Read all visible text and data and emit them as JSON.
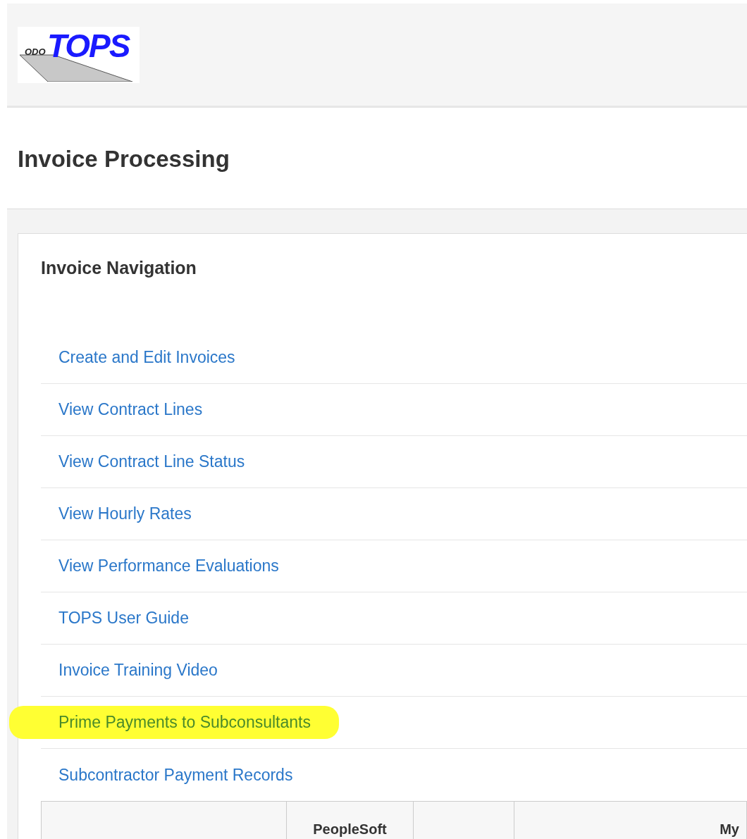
{
  "logo": {
    "prefix": "ODO",
    "name": "TOPS"
  },
  "page_title": "Invoice Processing",
  "panel": {
    "title": "Invoice Navigation",
    "links": [
      {
        "label": "Create and Edit Invoices",
        "highlighted": false
      },
      {
        "label": "View Contract Lines",
        "highlighted": false
      },
      {
        "label": "View Contract Line Status",
        "highlighted": false
      },
      {
        "label": "View Hourly Rates",
        "highlighted": false
      },
      {
        "label": "View Performance Evaluations",
        "highlighted": false
      },
      {
        "label": "TOPS User Guide",
        "highlighted": false
      },
      {
        "label": "Invoice Training Video",
        "highlighted": false
      },
      {
        "label": "Prime Payments to Subconsultants",
        "highlighted": true
      },
      {
        "label": "Subcontractor Payment Records",
        "highlighted": false
      }
    ],
    "table": {
      "columns": [
        "",
        "PeopleSoft",
        "",
        "My"
      ]
    }
  }
}
